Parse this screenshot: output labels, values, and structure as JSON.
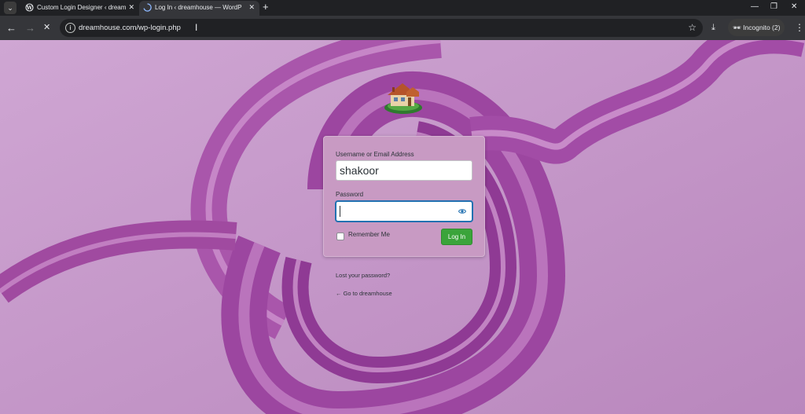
{
  "browser": {
    "tabs": [
      {
        "title": "Custom Login Designer ‹ dream",
        "active": false
      },
      {
        "title": "Log In ‹ dreamhouse — WordP",
        "active": true
      }
    ],
    "new_tab": "+",
    "url": "dreamhouse.com/wp-login.php",
    "incognito_label": "Incognito (2)"
  },
  "login": {
    "username_label": "Username or Email Address",
    "username_value": "shakoor",
    "password_label": "Password",
    "password_value": "",
    "remember_label": "Remember Me",
    "remember_checked": false,
    "submit_label": "Log In"
  },
  "links": {
    "lost_password": "Lost your password?",
    "back_to_site": "← Go to dreamhouse"
  },
  "colors": {
    "background": "#c99fc9",
    "ribbon": "#a04aa0",
    "button": "#3aa43a",
    "focus": "#2271b1"
  },
  "icons": [
    "tab-search-icon",
    "wordpress-icon",
    "loading-icon",
    "close-icon",
    "back-icon",
    "forward-icon",
    "stop-icon",
    "site-info-icon",
    "star-icon",
    "download-icon",
    "incognito-icon",
    "menu-icon",
    "eye-icon",
    "house-logo"
  ]
}
